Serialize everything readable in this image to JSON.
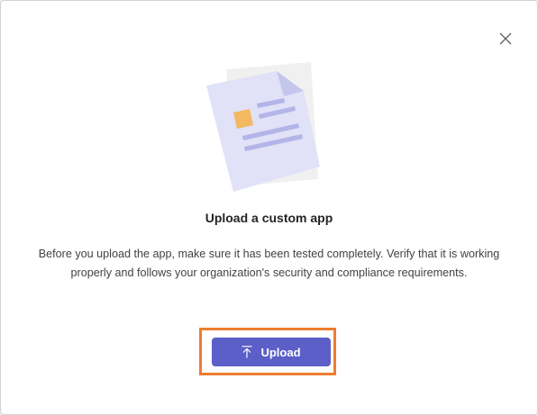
{
  "dialog": {
    "title": "Upload a custom app",
    "description": "Before you upload the app, make sure it has been tested completely. Verify that it is working properly and follows your organization's security and compliance requirements.",
    "upload_label": "Upload",
    "close_icon": "close-icon",
    "upload_icon": "arrow-up-to-line-icon",
    "illustration_icon": "document-icon"
  },
  "colors": {
    "primary_button": "#5b5fc7",
    "highlight_border": "#ed7d31",
    "document_fill": "#e1e1f7",
    "document_accent": "#f4b860"
  }
}
